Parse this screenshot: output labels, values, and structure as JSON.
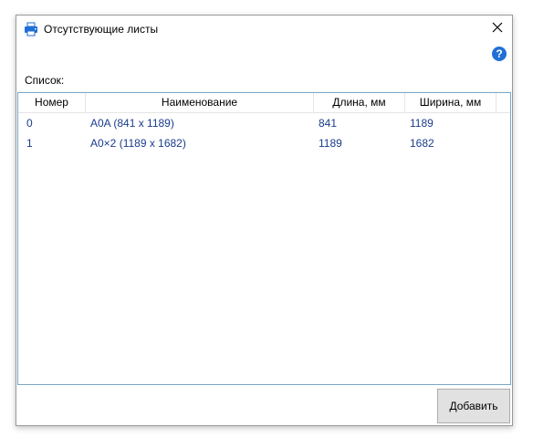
{
  "window": {
    "title": "Отсутствующие листы",
    "help_glyph": "?"
  },
  "list": {
    "label": "Список:",
    "columns": [
      "Номер",
      "Наименование",
      "Длина, мм",
      "Ширина, мм"
    ],
    "rows": [
      [
        "0",
        "A0A (841 x 1189)",
        "841",
        "1189"
      ],
      [
        "1",
        "A0×2 (1189 x 1682)",
        "1189",
        "1682"
      ]
    ]
  },
  "footer": {
    "add_label": "Добавить"
  },
  "icons": {
    "title": "printer-icon",
    "close": "close-icon",
    "help": "help-icon"
  },
  "colors": {
    "accent": "#1f6fd6",
    "row_text": "#1a3c8c",
    "grid_border": "#7aa7c7"
  }
}
